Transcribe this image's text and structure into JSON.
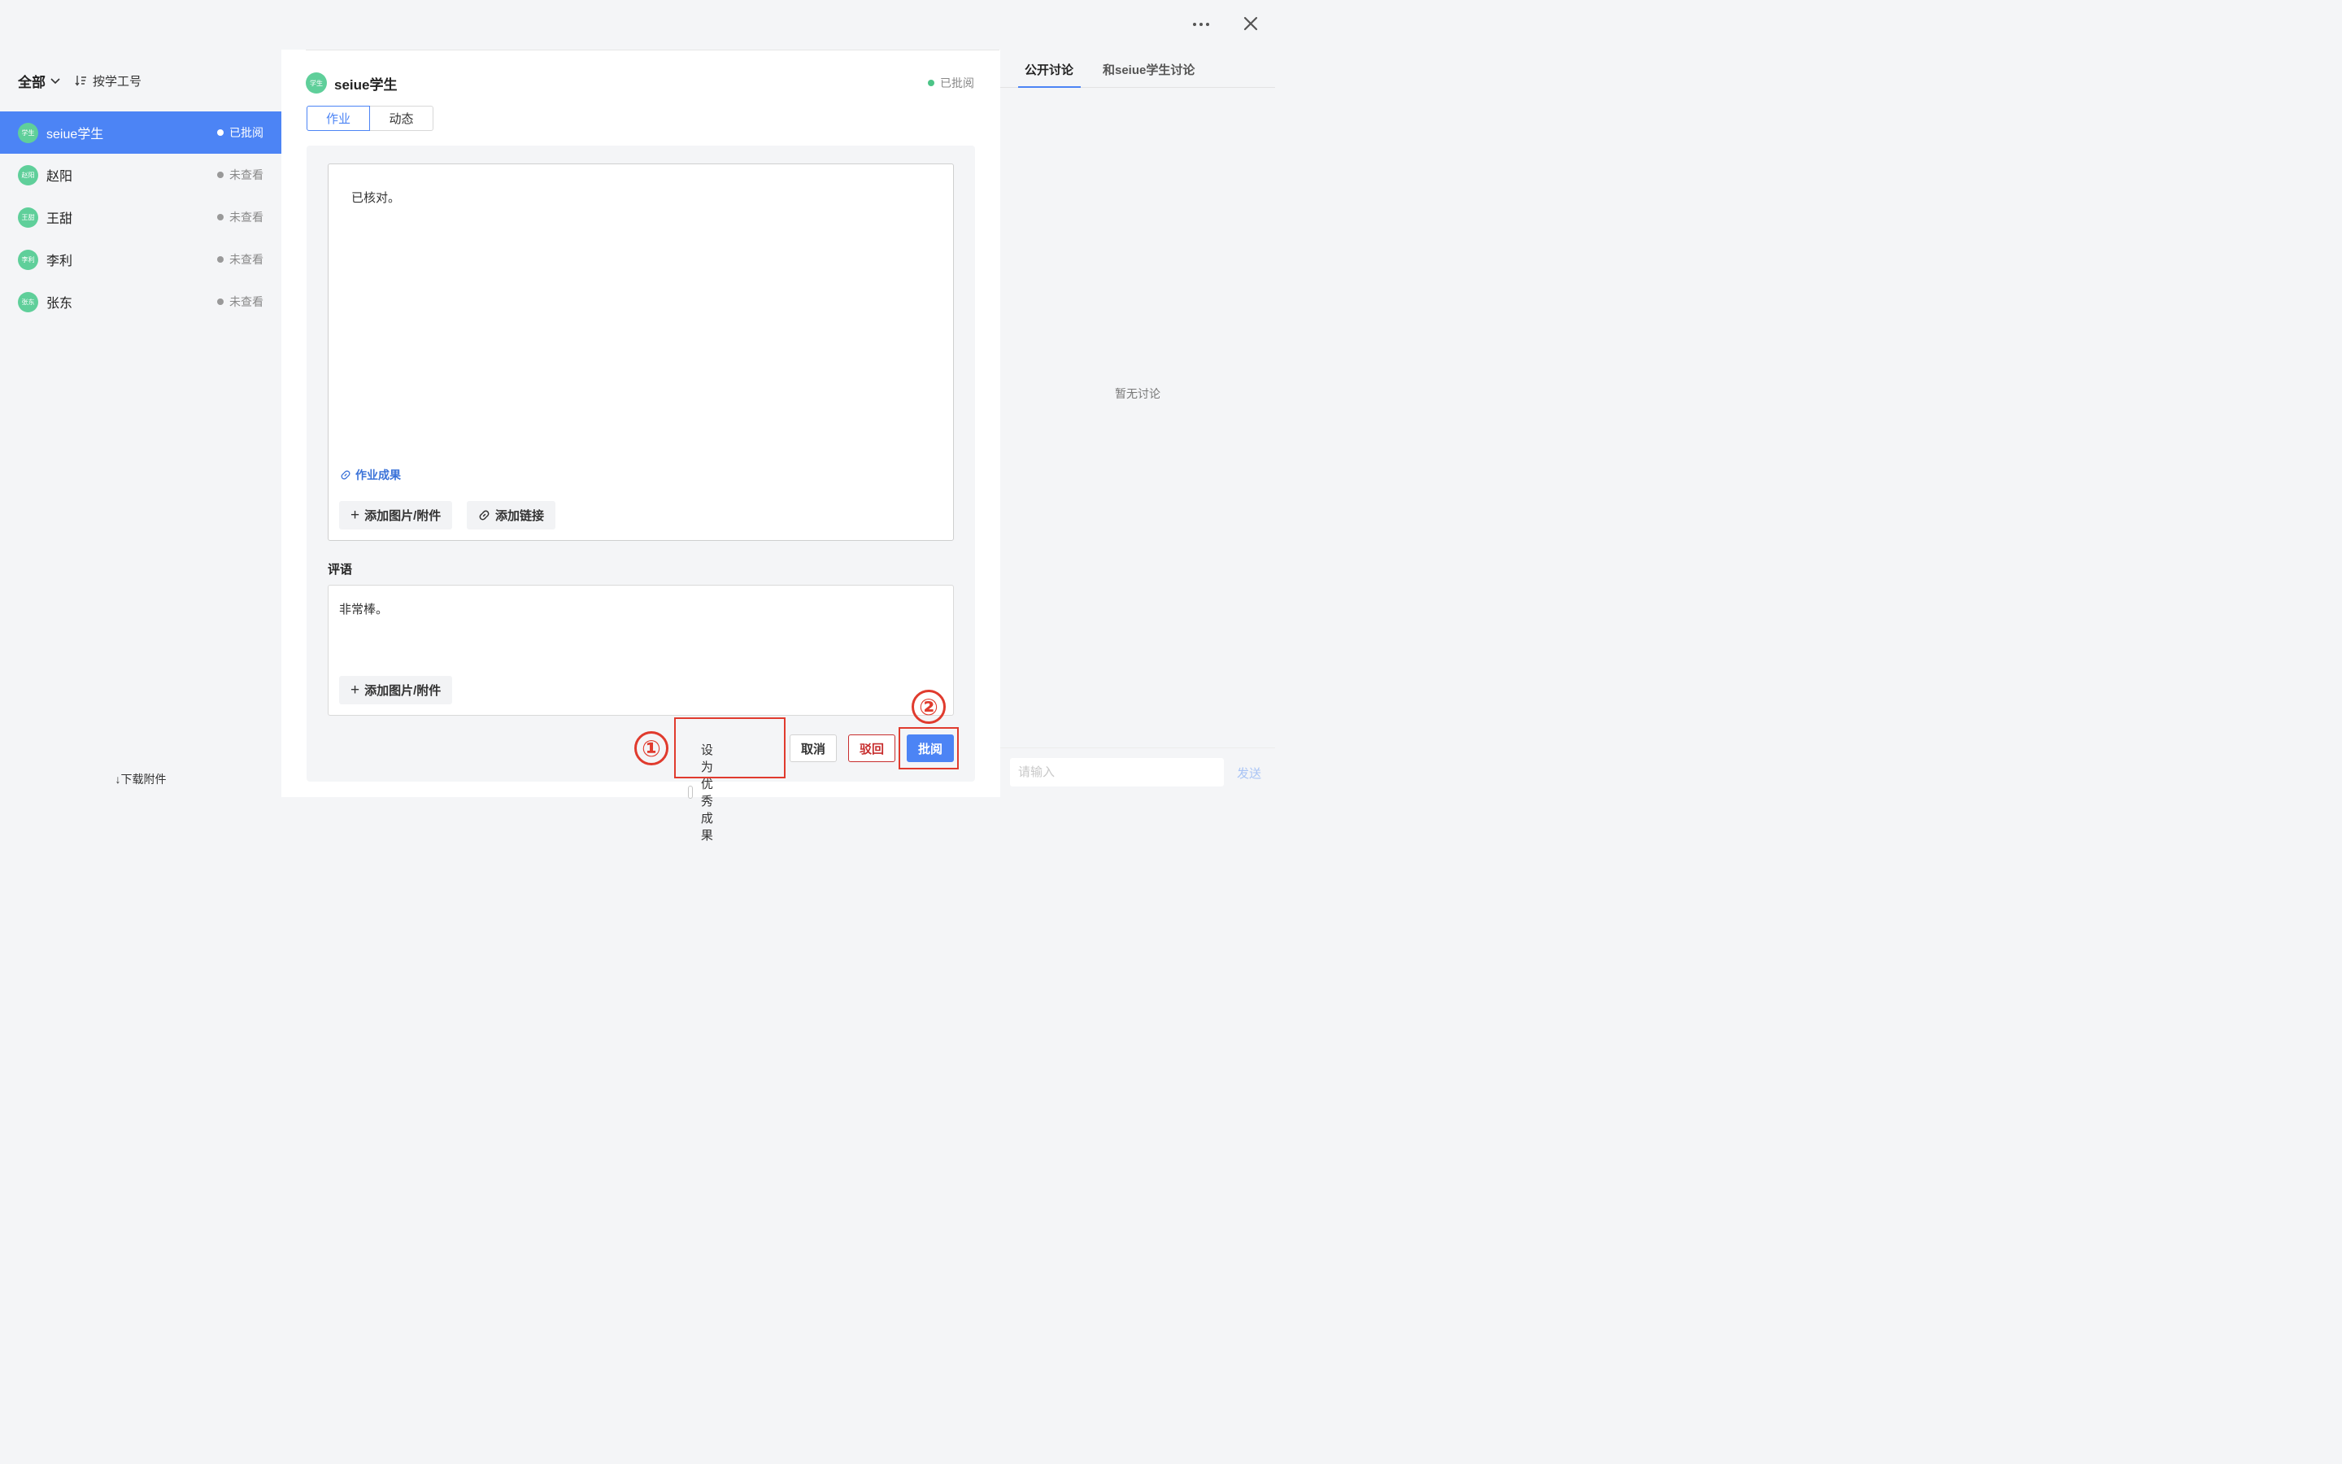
{
  "window": {
    "more_icon": "more-horizontal-icon",
    "close_icon": "close-icon"
  },
  "sidebar": {
    "filter_label": "全部",
    "sort_label": "按学工号",
    "students": [
      {
        "avatar": "学生",
        "name": "seiue学生",
        "status": "已批阅",
        "active": true
      },
      {
        "avatar": "赵阳",
        "name": "赵阳",
        "status": "未查看",
        "active": false
      },
      {
        "avatar": "王甜",
        "name": "王甜",
        "status": "未查看",
        "active": false
      },
      {
        "avatar": "李利",
        "name": "李利",
        "status": "未查看",
        "active": false
      },
      {
        "avatar": "张东",
        "name": "张东",
        "status": "未查看",
        "active": false
      }
    ],
    "download_label": "下载附件"
  },
  "main": {
    "student_avatar": "学生",
    "student_name": "seiue学生",
    "student_status": "已批阅",
    "tabs": [
      {
        "label": "作业",
        "active": true
      },
      {
        "label": "动态",
        "active": false
      }
    ],
    "submission_text": "已核对。",
    "result_link_label": "作业成果",
    "add_attachment_label": "添加图片/附件",
    "add_link_label": "添加链接",
    "comment_label": "评语",
    "comment_text": "非常棒。",
    "comment_add_attachment_label": "添加图片/附件",
    "excellent_label": "设为优秀成果",
    "cancel_label": "取消",
    "reject_label": "驳回",
    "approve_label": "批阅"
  },
  "annotations": {
    "first": "①",
    "second": "②"
  },
  "discussion": {
    "tab_public": "公开讨论",
    "tab_private": "和seiue学生讨论",
    "empty_text": "暂无讨论",
    "input_placeholder": "请输入",
    "send_label": "发送"
  },
  "colors": {
    "accent": "#4c84f5",
    "avatar": "#5fcf9a",
    "reviewed_dot": "#4cc487",
    "reject": "#c72d2d",
    "annotation": "#e03b2e"
  }
}
